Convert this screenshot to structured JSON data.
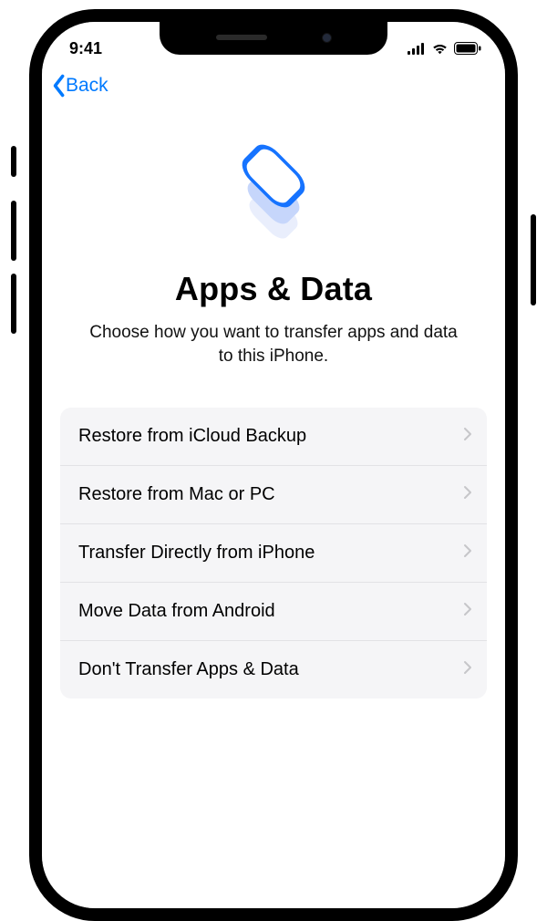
{
  "status": {
    "time": "9:41"
  },
  "nav": {
    "back_label": "Back"
  },
  "hero": {
    "title": "Apps & Data",
    "subtitle": "Choose how you want to transfer apps and data to this iPhone.",
    "icon_name": "layered-squares-icon"
  },
  "options": [
    {
      "label": "Restore from iCloud Backup"
    },
    {
      "label": "Restore from Mac or PC"
    },
    {
      "label": "Transfer Directly from iPhone"
    },
    {
      "label": "Move Data from Android"
    },
    {
      "label": "Don't Transfer Apps & Data"
    }
  ],
  "colors": {
    "accent": "#007aff"
  }
}
